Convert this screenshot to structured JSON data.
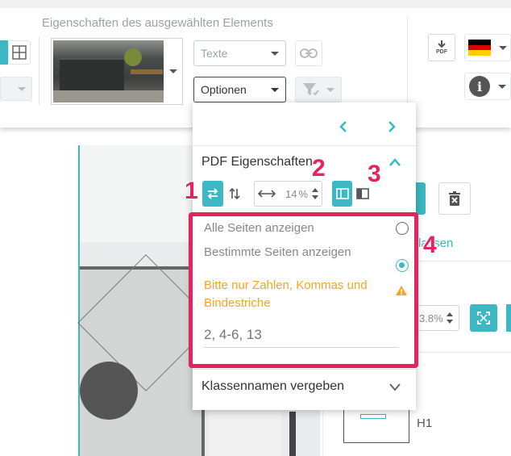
{
  "toolbar": {
    "title": "Eigenschaften des ausgewählten Elements",
    "texte_select": "Texte",
    "optionen_select": "Optionen",
    "pdf_label": "PDF",
    "flag": "german-flag",
    "info": "i"
  },
  "popup": {
    "section_pdf": "PDF Eigenschaften",
    "margin_value": "14",
    "margin_unit": "%",
    "radio_all": "Alle Seiten anzeigen",
    "radio_some": "Bestimmte Seiten anzeigen",
    "warning": "Bitte nur Zahlen, Kommas und Bindestriche",
    "pages_placeholder": "2, 4-6, 13",
    "section_classes": "Klassennamen vergeben"
  },
  "right_panel": {
    "klassen_fragment": "lassen",
    "zoom_value": "3.8",
    "zoom_unit": "%",
    "h1_label": "H1"
  },
  "annotations": [
    "1",
    "2",
    "3",
    "4"
  ],
  "colors": {
    "accent": "#3bb8c3",
    "highlight": "#e5235d",
    "warning": "#f5a623"
  }
}
